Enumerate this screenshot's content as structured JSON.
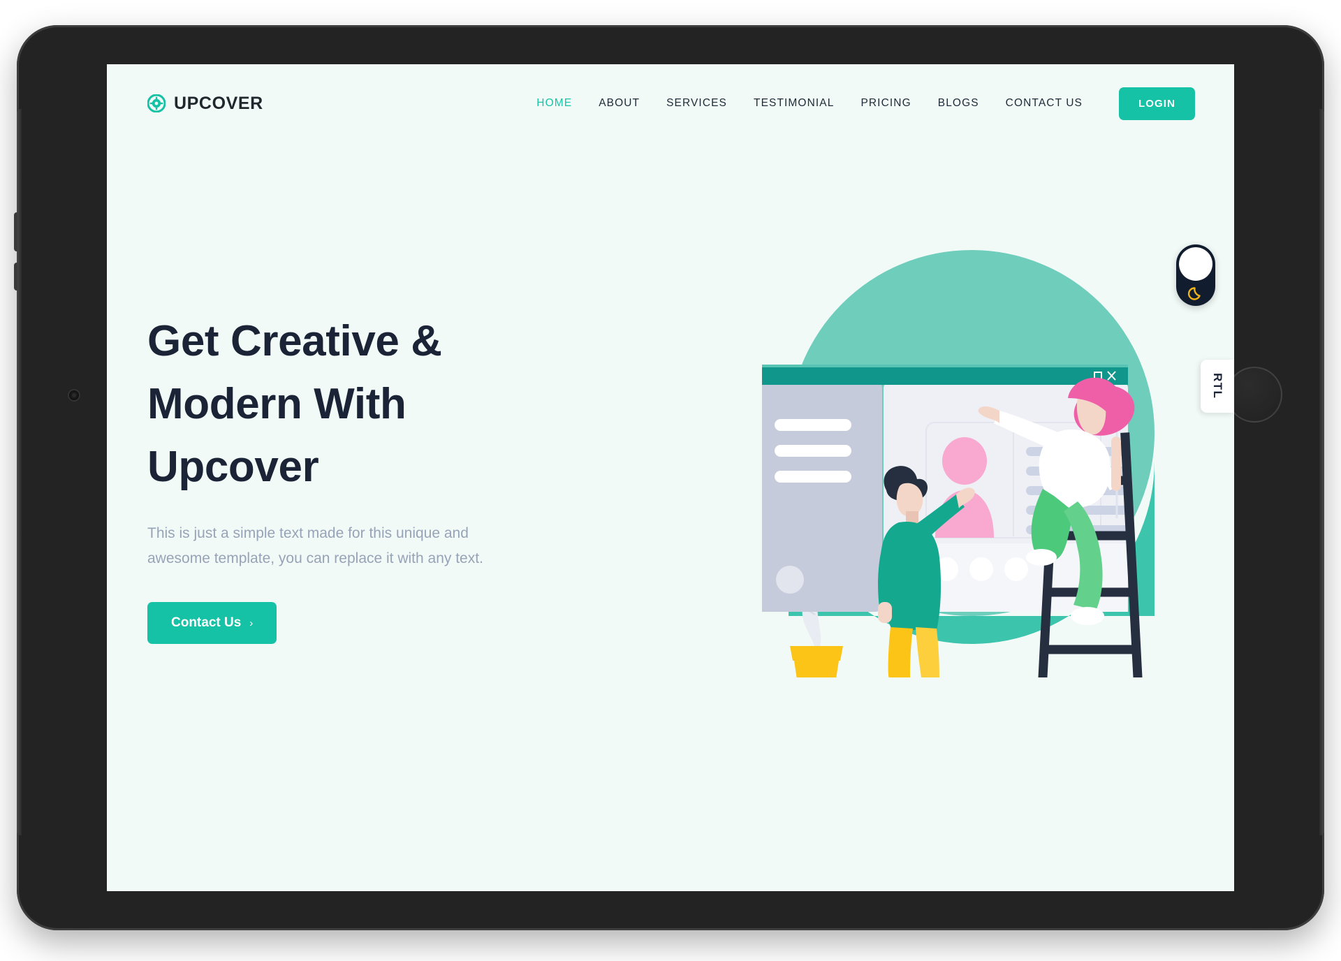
{
  "device": {
    "type": "tablet-landscape",
    "camera_icon": "camera-dot",
    "home_button_icon": "home-circle-icon"
  },
  "header": {
    "brand": {
      "icon": "gear-flower-icon",
      "name": "UPCOVER"
    },
    "nav_items": [
      {
        "label": "HOME",
        "active": true
      },
      {
        "label": "ABOUT",
        "active": false
      },
      {
        "label": "SERVICES",
        "active": false
      },
      {
        "label": "TESTIMONIAL",
        "active": false
      },
      {
        "label": "PRICING",
        "active": false
      },
      {
        "label": "BLOGS",
        "active": false
      },
      {
        "label": "CONTACT US",
        "active": false
      }
    ],
    "login_label": "LOGIN"
  },
  "hero": {
    "title_line1": "Get Creative &",
    "title_line2": "Modern With",
    "title_line3": "Upcover",
    "subtitle_line1": "This is just a simple text made for this unique and",
    "subtitle_line2": "awesome template, you can replace it with any text.",
    "cta_label": "Contact Us",
    "cta_chevron": "›"
  },
  "widgets": {
    "dark_mode_toggle": {
      "icon": "moon-icon",
      "state": "light"
    },
    "rtl_tab": {
      "label": "RTL"
    }
  },
  "illustration": {
    "browser_window": {
      "maximize_icon": "maximize-icon",
      "close_icon": "close-icon"
    },
    "elements": [
      "teal-circle-backdrop",
      "browser-window-mockup",
      "sidebar-placeholder-bars",
      "profile-card-avatar",
      "text-placeholder-lines",
      "scrollbar",
      "man-pointing",
      "woman-on-ladder",
      "ladder",
      "potted-plant"
    ]
  },
  "colors": {
    "accent": "#16c2a6",
    "accent_light": "#7ad6c6",
    "screen_bg": "#f2faf8",
    "heading": "#1b2436",
    "body_text": "#97a3b6",
    "nav_text": "#1e2a37",
    "dark_navy": "#111c2e",
    "pink": "#f49ac8",
    "pink_hair": "#ef5fa8",
    "yellow": "#fcc416",
    "green_pants": "#4cc97a",
    "title_bar": "#10968a",
    "device_frame": "#232323"
  }
}
